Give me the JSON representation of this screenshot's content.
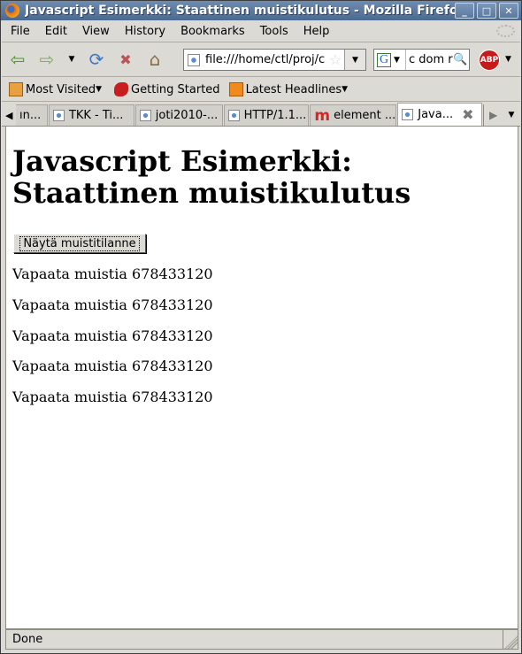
{
  "window": {
    "title": "Javascript Esimerkki: Staattinen muistikulutus - Mozilla Firefox",
    "controls": {
      "minimize": "_",
      "maximize": "□",
      "close": "✕"
    }
  },
  "menu": [
    "File",
    "Edit",
    "View",
    "History",
    "Bookmarks",
    "Tools",
    "Help"
  ],
  "nav": {
    "back_icon": "⇦",
    "forward_icon": "⇨",
    "history_dropdown_icon": "▼",
    "reload_icon": "⟳",
    "stop_icon": "✖",
    "home_icon": "⌂",
    "url": "file:///home/ctl/proj/c",
    "bookmark_star": "☆",
    "url_dropdown": "▼",
    "search_engine": "G",
    "search_engine_dropdown": "▼",
    "search_value": "c dom r",
    "search_icon": "🔍",
    "adblock_label": "ABP",
    "adblock_dropdown": "▼"
  },
  "bookmarks": [
    {
      "label": "Most Visited",
      "dropdown": "▼"
    },
    {
      "label": "Getting Started",
      "dropdown": ""
    },
    {
      "label": "Latest Headlines",
      "dropdown": "▼"
    }
  ],
  "tabs": {
    "scroll_left": "◀",
    "items": [
      {
        "label": "ın..."
      },
      {
        "label": "TKK - Ti..."
      },
      {
        "label": "joti2010-..."
      },
      {
        "label": "HTTP/1.1..."
      },
      {
        "label": "element ..."
      },
      {
        "label": "Java...",
        "active": true
      }
    ],
    "close_icon": "✖",
    "scroll_right": "▶",
    "list_all": "▼"
  },
  "page": {
    "heading": "Javascript Esimerkki: Staattinen muistikulutus",
    "button_label": "Näytä muistitilanne",
    "lines": [
      "Vapaata muistia 678433120",
      "Vapaata muistia 678433120",
      "Vapaata muistia 678433120",
      "Vapaata muistia 678433120",
      "Vapaata muistia 678433120"
    ]
  },
  "status": {
    "text": "Done"
  }
}
